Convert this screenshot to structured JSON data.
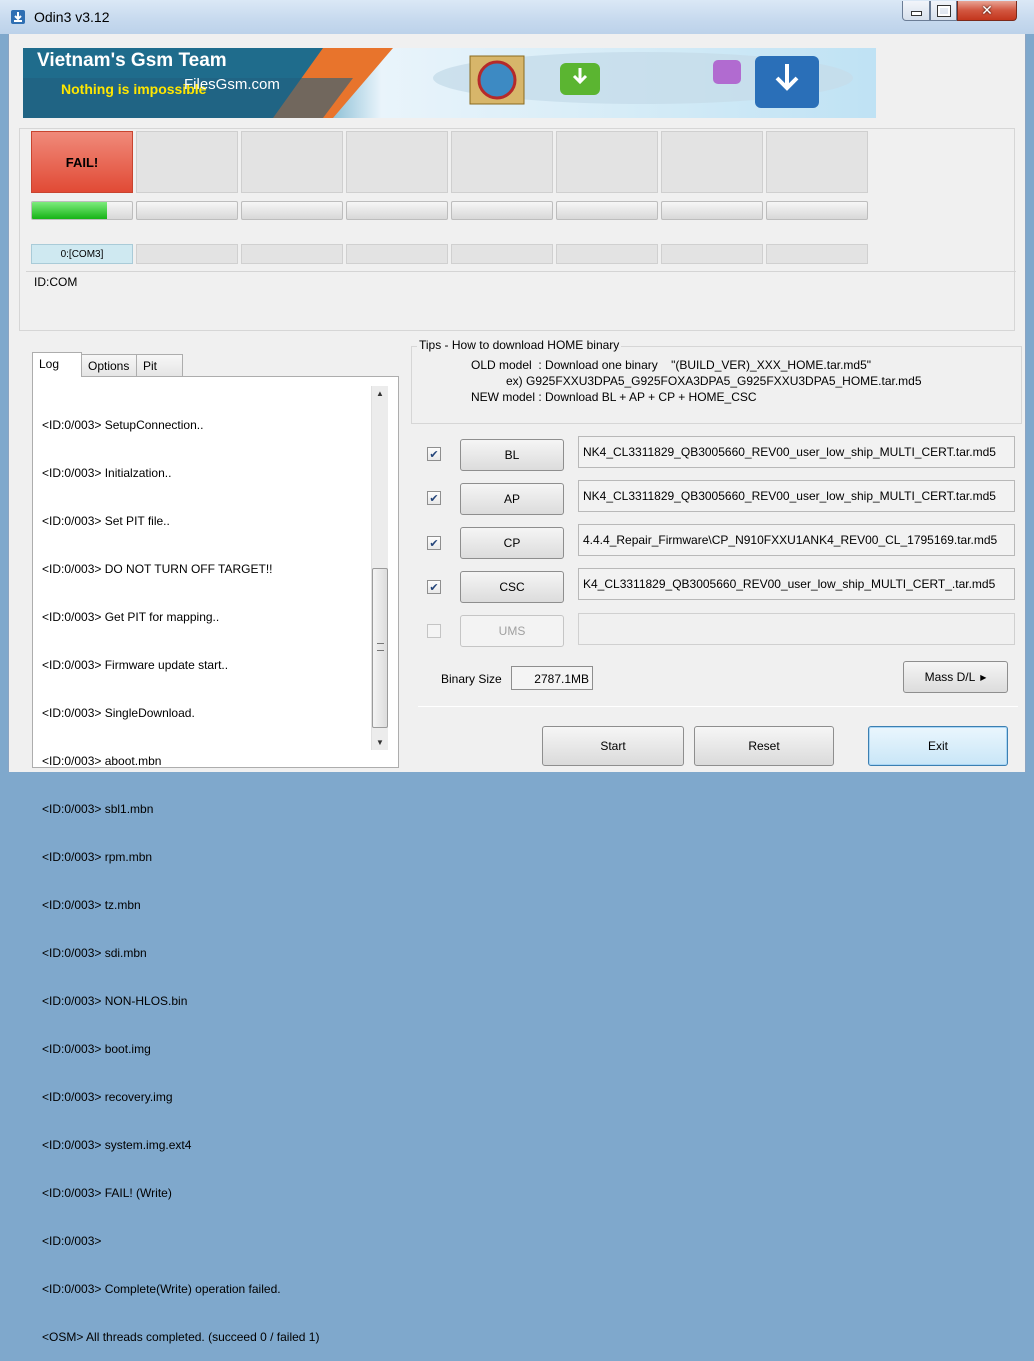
{
  "window": {
    "title": "Odin3 v3.12",
    "colors": {
      "accent": "#3c7fb1",
      "fail": "#e14a35",
      "progress": "#16b316"
    }
  },
  "banner": {
    "brand": "Vietnam's Gsm Team",
    "slogan": "Nothing is impossible",
    "watermark": "FilesGsm.com"
  },
  "status": {
    "slot_label": "FAIL!",
    "progress": 0.75,
    "com_label": "0:[COM3]",
    "id_com_label": "ID:COM"
  },
  "tabs": [
    "Log",
    "Options",
    "Pit"
  ],
  "log": [
    "<ID:0/003> SetupConnection..",
    "<ID:0/003> Initialzation..",
    "<ID:0/003> Set PIT file..",
    "<ID:0/003> DO NOT TURN OFF TARGET!!",
    "<ID:0/003> Get PIT for mapping..",
    "<ID:0/003> Firmware update start..",
    "<ID:0/003> SingleDownload.",
    "<ID:0/003> aboot.mbn",
    "<ID:0/003> sbl1.mbn",
    "<ID:0/003> rpm.mbn",
    "<ID:0/003> tz.mbn",
    "<ID:0/003> sdi.mbn",
    "<ID:0/003> NON-HLOS.bin",
    "<ID:0/003> boot.img",
    "<ID:0/003> recovery.img",
    "<ID:0/003> system.img.ext4",
    "<ID:0/003> FAIL! (Write)",
    "<ID:0/003>",
    "<ID:0/003> Complete(Write) operation failed.",
    "<OSM> All threads completed. (succeed 0 / failed 1)"
  ],
  "tips": {
    "title": "Tips - How to download HOME binary",
    "old": "OLD model  : Download one binary    \"(BUILD_VER)_XXX_HOME.tar.md5\"",
    "ex": "ex) G925FXXU3DPA5_G925FOXA3DPA5_G925FXXU3DPA5_HOME.tar.md5",
    "new": "NEW model : Download BL + AP + CP + HOME_CSC"
  },
  "files": [
    {
      "label": "BL",
      "checked": true,
      "path": "NK4_CL3311829_QB3005660_REV00_user_low_ship_MULTI_CERT.tar.md5"
    },
    {
      "label": "AP",
      "checked": true,
      "path": "NK4_CL3311829_QB3005660_REV00_user_low_ship_MULTI_CERT.tar.md5"
    },
    {
      "label": "CP",
      "checked": true,
      "path": "4.4.4_Repair_Firmware\\CP_N910FXXU1ANK4_REV00_CL_1795169.tar.md5"
    },
    {
      "label": "CSC",
      "checked": true,
      "path": "K4_CL3311829_QB3005660_REV00_user_low_ship_MULTI_CERT_.tar.md5"
    },
    {
      "label": "UMS",
      "checked": false,
      "path": ""
    }
  ],
  "binary": {
    "label": "Binary Size",
    "value": "2787.1MB"
  },
  "buttons": {
    "massdl": "Mass D/L",
    "start": "Start",
    "reset": "Reset",
    "exit": "Exit"
  }
}
